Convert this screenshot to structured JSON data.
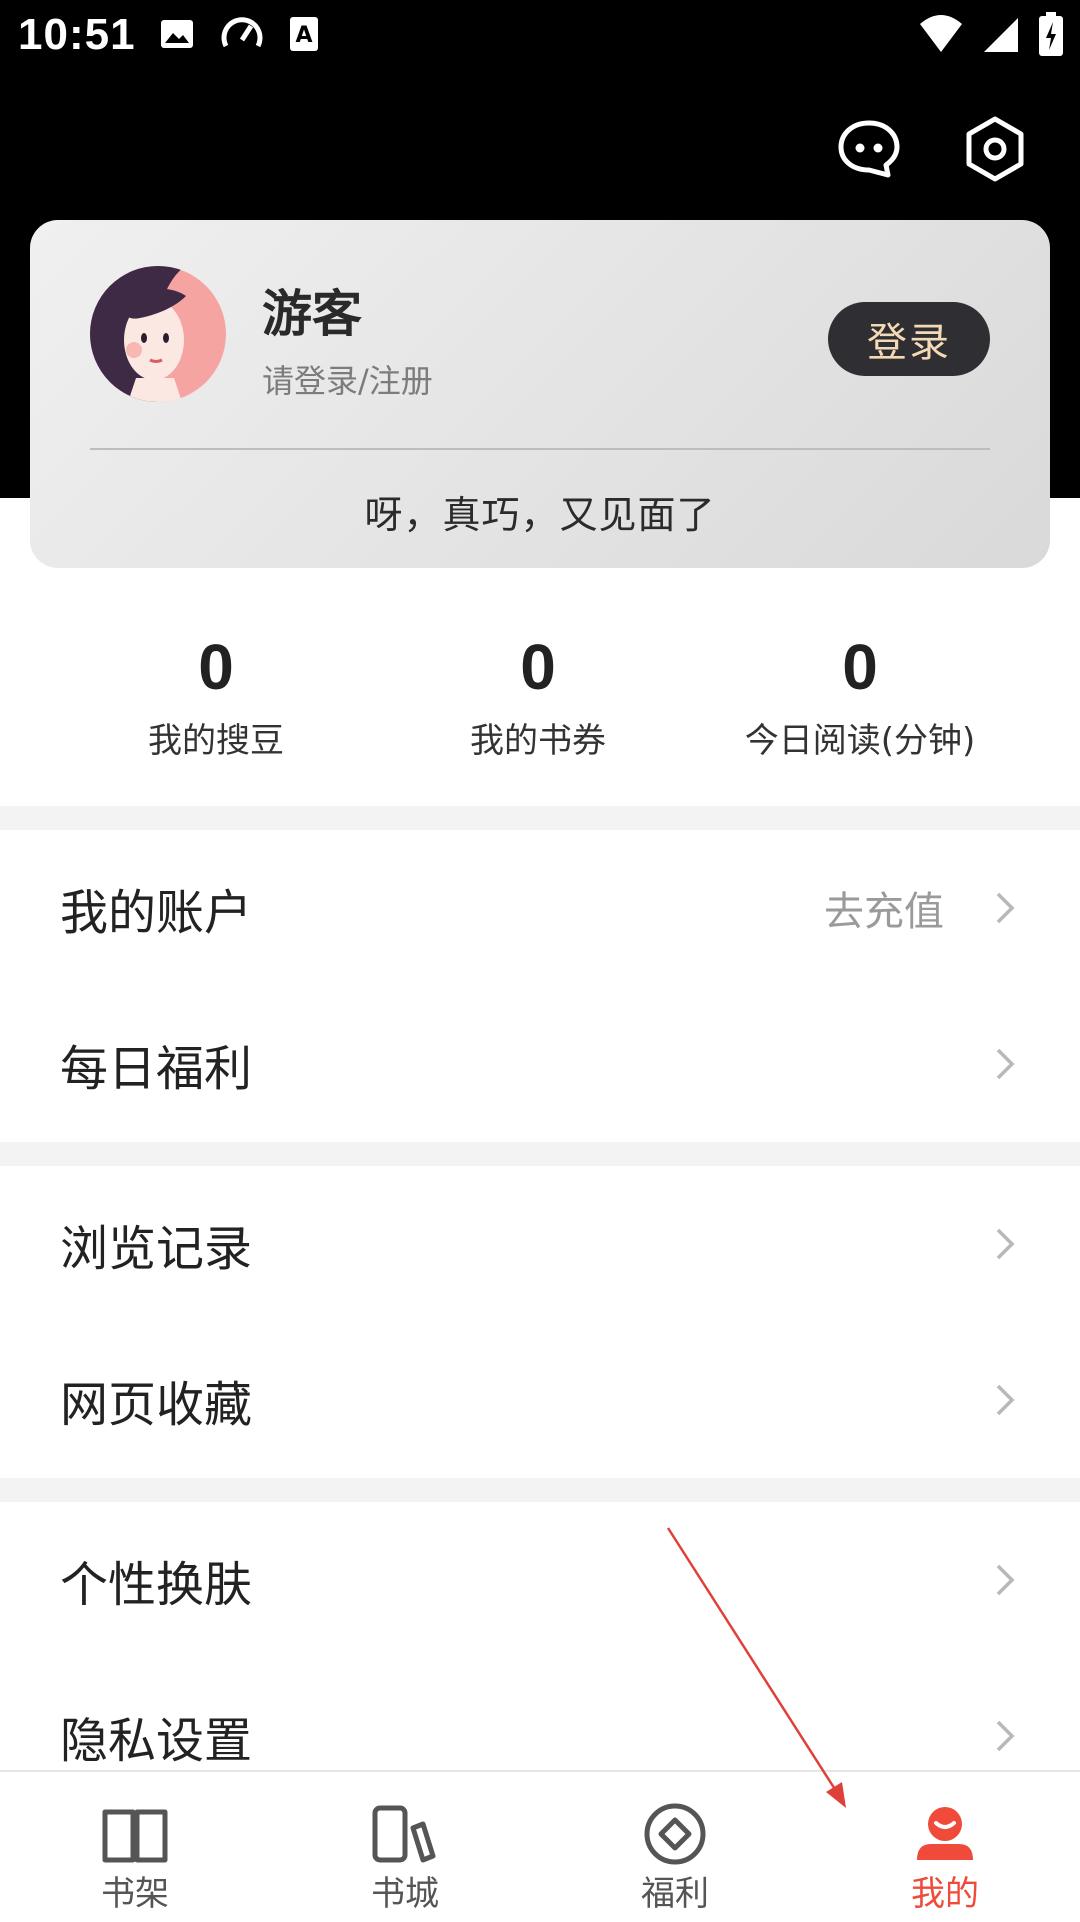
{
  "status_bar": {
    "time": "10:51"
  },
  "profile": {
    "username": "游客",
    "login_hint": "请登录/注册",
    "login_button": "登录",
    "greeting": "呀，真巧，又见面了"
  },
  "stats": [
    {
      "value": "0",
      "label": "我的搜豆"
    },
    {
      "value": "0",
      "label": "我的书券"
    },
    {
      "value": "0",
      "label": "今日阅读(分钟)"
    }
  ],
  "menu": {
    "account": {
      "label": "我的账户",
      "aside": "去充值"
    },
    "daily": {
      "label": "每日福利"
    },
    "history": {
      "label": "浏览记录"
    },
    "bookmarks": {
      "label": "网页收藏"
    },
    "skin": {
      "label": "个性换肤"
    },
    "privacy": {
      "label": "隐私设置"
    }
  },
  "tabbar": {
    "tabs": [
      {
        "label": "书架",
        "icon": "book-open-icon"
      },
      {
        "label": "书城",
        "icon": "bookstore-icon"
      },
      {
        "label": "福利",
        "icon": "diamond-circle-icon"
      },
      {
        "label": "我的",
        "icon": "user-icon",
        "active": true
      }
    ]
  },
  "colors": {
    "accent": "#f04a3a",
    "header": "#000000",
    "login_button_bg": "#2f2f33",
    "login_button_text": "#f4d9b6",
    "annotation": "#e0403a"
  }
}
